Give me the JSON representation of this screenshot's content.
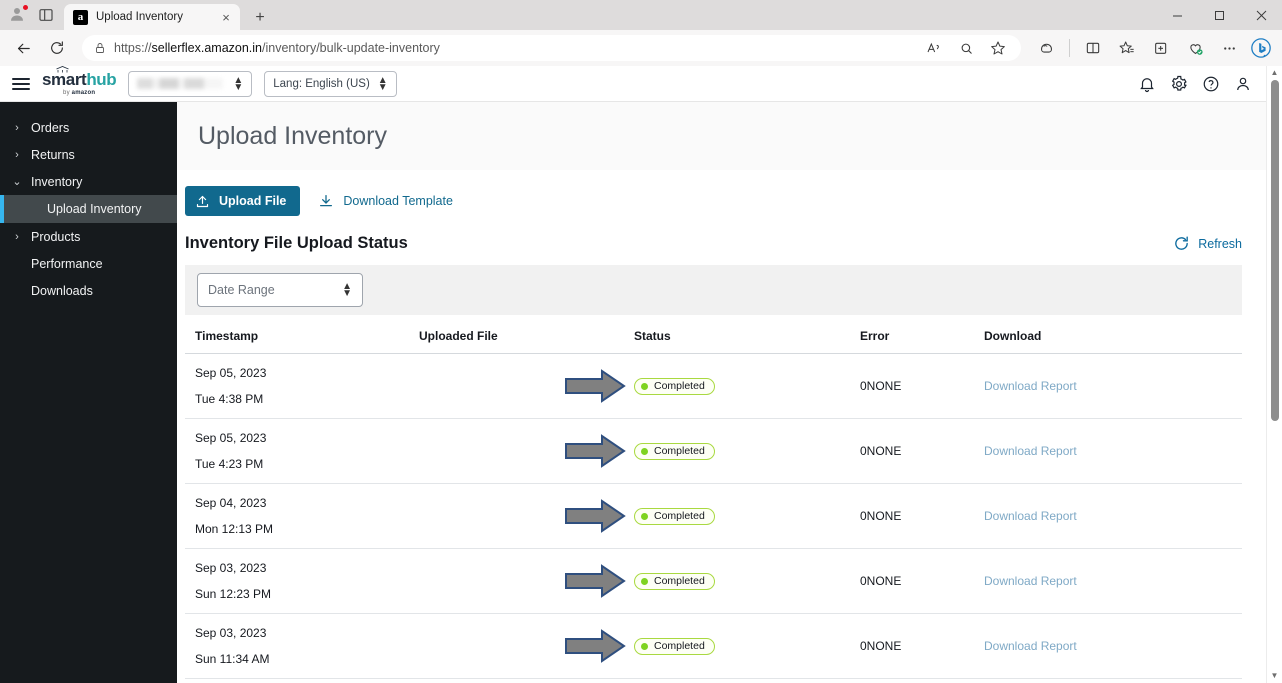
{
  "browser": {
    "tab": {
      "title": "Upload Inventory",
      "favicon_letter": "a",
      "close_label": "×"
    },
    "new_tab_label": "+",
    "window_controls": {
      "minimize": "─",
      "maximize": "❐",
      "close": "×"
    },
    "address": {
      "scheme": "https://",
      "host": "sellerflex.amazon.in",
      "path": "/inventory/bulk-update-inventory"
    },
    "icons": {
      "profile": "profile-avatar-icon",
      "splitview": "split-screen-icon",
      "back": "back-arrow-icon",
      "reload": "reload-icon",
      "lock": "site-lock-icon",
      "read_aloud": "read-aloud-icon",
      "search": "search-icon",
      "favorite": "star-icon",
      "copilot": "copilot-icon",
      "split": "split-screen-toolbar-icon",
      "favorites_list": "favorites-list-icon",
      "collections": "collections-icon",
      "browser_essentials": "browser-essentials-icon",
      "settings_more": "more-options-icon",
      "bing": "bing-chat-icon"
    }
  },
  "appbar": {
    "menu_icon": "hamburger-menu-icon",
    "logo": {
      "part1": "smart",
      "part2": "hub",
      "byline_prefix": "by ",
      "byline_brand": "amazon"
    },
    "account_select": {
      "value": "",
      "placeholder": ""
    },
    "lang_select": {
      "value": "Lang: English (US)"
    },
    "icons": {
      "notifications": "bell-icon",
      "settings": "gear-icon",
      "help": "help-icon",
      "account": "user-icon"
    }
  },
  "sidebar": {
    "items": [
      {
        "label": "Orders",
        "chevron": "›",
        "expanded": false,
        "active": false,
        "sub": false
      },
      {
        "label": "Returns",
        "chevron": "›",
        "expanded": false,
        "active": false,
        "sub": false
      },
      {
        "label": "Inventory",
        "chevron": "⌄",
        "expanded": true,
        "active": false,
        "sub": false
      },
      {
        "label": "Upload Inventory",
        "chevron": "",
        "expanded": false,
        "active": true,
        "sub": true
      },
      {
        "label": "Products",
        "chevron": "›",
        "expanded": false,
        "active": false,
        "sub": false
      },
      {
        "label": "Performance",
        "chevron": "",
        "expanded": false,
        "active": false,
        "sub": false
      },
      {
        "label": "Downloads",
        "chevron": "",
        "expanded": false,
        "active": false,
        "sub": false
      }
    ]
  },
  "page": {
    "title": "Upload Inventory",
    "upload_button": {
      "label": "Upload File",
      "icon": "upload-icon"
    },
    "download_template": {
      "label": "Download Template",
      "icon": "download-icon"
    },
    "section_title": "Inventory File Upload Status",
    "refresh": {
      "label": "Refresh",
      "icon": "refresh-icon"
    },
    "date_range": {
      "label": "Date Range",
      "icon": "stepper-chevrons-icon"
    }
  },
  "table": {
    "columns": [
      "Timestamp",
      "Uploaded File",
      "Status",
      "Error",
      "Download"
    ],
    "rows": [
      {
        "date": "Sep 05, 2023",
        "time": "Tue 4:38 PM",
        "file": "",
        "status": "Completed",
        "error": "0NONE",
        "download": "Download Report"
      },
      {
        "date": "Sep 05, 2023",
        "time": "Tue 4:23 PM",
        "file": "",
        "status": "Completed",
        "error": "0NONE",
        "download": "Download Report"
      },
      {
        "date": "Sep 04, 2023",
        "time": "Mon 12:13 PM",
        "file": "",
        "status": "Completed",
        "error": "0NONE",
        "download": "Download Report"
      },
      {
        "date": "Sep 03, 2023",
        "time": "Sun 12:23 PM",
        "file": "",
        "status": "Completed",
        "error": "0NONE",
        "download": "Download Report"
      },
      {
        "date": "Sep 03, 2023",
        "time": "Sun 11:34 AM",
        "file": "",
        "status": "Completed",
        "error": "0NONE",
        "download": "Download Report"
      }
    ]
  },
  "annotations": {
    "arrow_count": 5,
    "arrow_fill": "#808080",
    "arrow_stroke": "#2f4f7f",
    "description": "grey block arrows pointing at each Completed status badge"
  },
  "colors": {
    "primary_button": "#11698e",
    "link": "#11698e",
    "sidebar_bg": "#161a1d",
    "sidebar_active_bg": "#42494c",
    "sidebar_active_accent": "#36b6ef",
    "badge_border": "#a9d940",
    "badge_dot": "#7ed321",
    "logo_teal": "#27a3a3",
    "page_title": "#545b64"
  },
  "scrollbar": {
    "up_arrow": "▲",
    "down_arrow": "▼"
  }
}
